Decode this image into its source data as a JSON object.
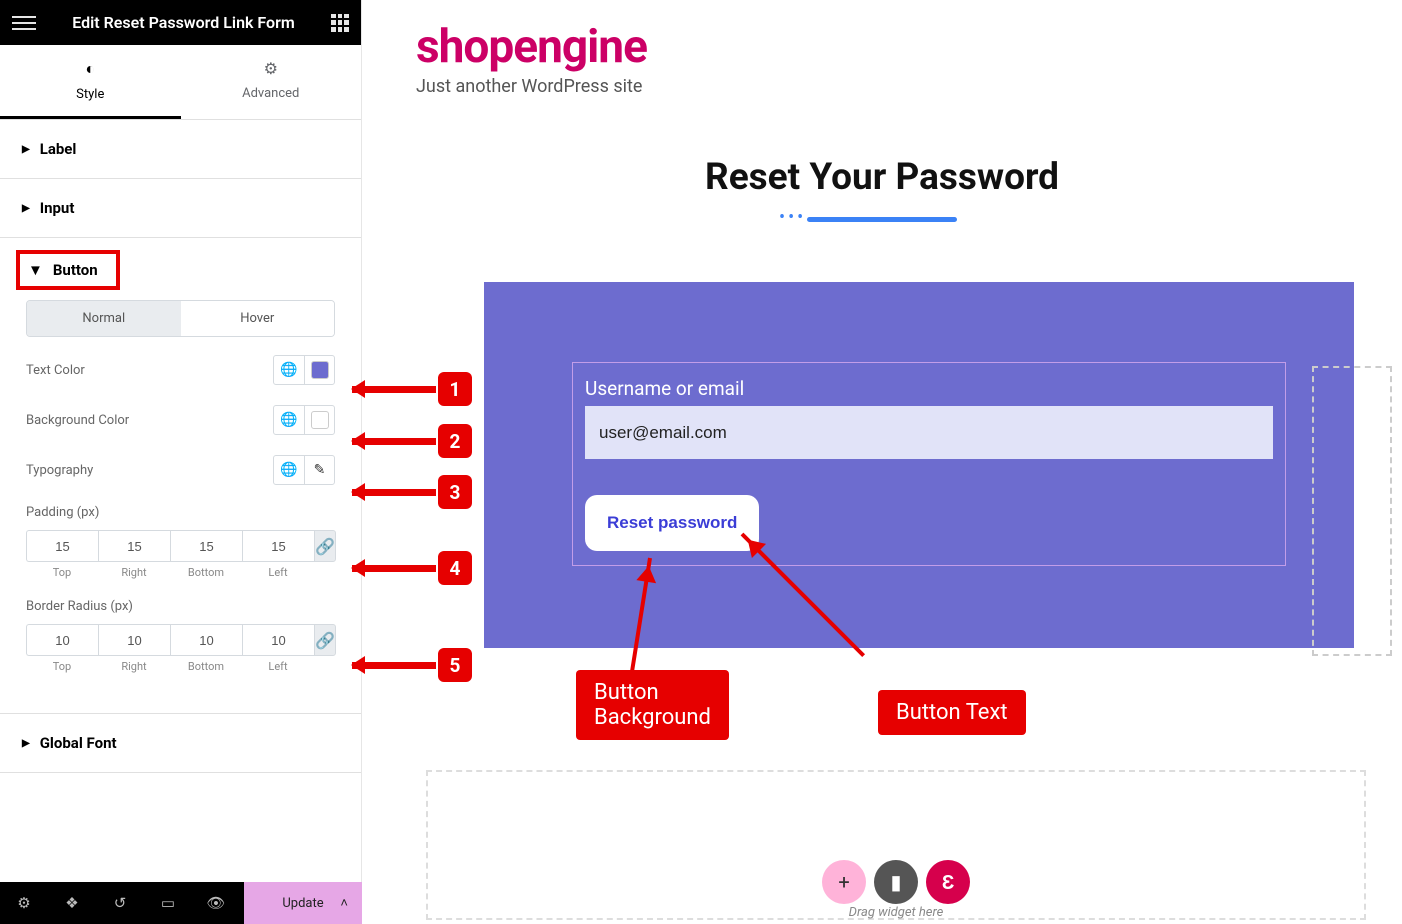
{
  "header": {
    "title": "Edit Reset Password Link Form"
  },
  "tabs": {
    "style": "Style",
    "advanced": "Advanced"
  },
  "sections": {
    "label": "Label",
    "input": "Input",
    "button": "Button",
    "global_font": "Global Font"
  },
  "toggle": {
    "normal": "Normal",
    "hover": "Hover"
  },
  "controls": {
    "text_color": "Text Color",
    "bg_color": "Background Color",
    "typography": "Typography",
    "padding": "Padding (px)",
    "radius": "Border Radius (px)"
  },
  "padding": {
    "top": "15",
    "right": "15",
    "bottom": "15",
    "left": "15"
  },
  "radius": {
    "top": "10",
    "right": "10",
    "bottom": "10",
    "left": "10"
  },
  "sublabels": {
    "top": "Top",
    "right": "Right",
    "bottom": "Bottom",
    "left": "Left"
  },
  "colors": {
    "text_color": "#6d6ccf",
    "bg_color": "#ffffff"
  },
  "update_btn": "Update",
  "site": {
    "title": "shopengine",
    "tagline": "Just another WordPress site"
  },
  "page_title": "Reset Your Password",
  "form": {
    "label": "Username or email",
    "value": "user@email.com",
    "button": "Reset password"
  },
  "drop": "Drag widget here",
  "markers": {
    "m1": "1",
    "m2": "2",
    "m3": "3",
    "m4": "4",
    "m5": "5"
  },
  "callouts": {
    "bg": "Button\nBackground",
    "text": "Button Text"
  }
}
